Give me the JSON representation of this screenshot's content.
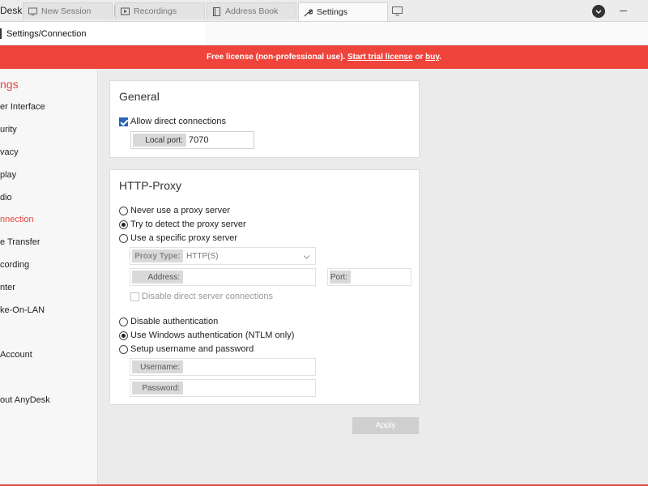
{
  "app": {
    "title": "Desk"
  },
  "tabs": [
    {
      "label": "New Session",
      "icon": "monitor-icon"
    },
    {
      "label": "Recordings",
      "icon": "play-icon"
    },
    {
      "label": "Address Book",
      "icon": "book-icon"
    },
    {
      "label": "Settings",
      "icon": "wrench-icon",
      "active": true
    }
  ],
  "address": {
    "path": "Settings/Connection"
  },
  "banner": {
    "prefix": "Free license (non-professional use). ",
    "trial_link": "Start trial license",
    "middle": " or ",
    "buy_link": "buy",
    "suffix": ".",
    "color": "#ef443b"
  },
  "sidebar": {
    "heading": "ngs",
    "items": [
      {
        "label": "er Interface"
      },
      {
        "label": "urity"
      },
      {
        "label": "vacy"
      },
      {
        "label": "play"
      },
      {
        "label": "dio"
      },
      {
        "label": "nnection",
        "active": true
      },
      {
        "label": "e Transfer"
      },
      {
        "label": "cording"
      },
      {
        "label": "nter"
      },
      {
        "label": "ke-On-LAN"
      },
      {
        "label": " Account"
      },
      {
        "label": "out AnyDesk"
      }
    ]
  },
  "general": {
    "title": "General",
    "allow_direct": {
      "label": "Allow direct connections",
      "checked": true
    },
    "local_port": {
      "label": "Local port:",
      "value": "7070"
    }
  },
  "proxy": {
    "title": "HTTP-Proxy",
    "mode_options": [
      {
        "label": "Never use a proxy server",
        "selected": false
      },
      {
        "label": "Try to detect the proxy server",
        "selected": true
      },
      {
        "label": "Use a specific proxy server",
        "selected": false
      }
    ],
    "proxy_type": {
      "label": "Proxy Type:",
      "value": "HTTP(S)"
    },
    "address": {
      "label": "Address:",
      "value": ""
    },
    "port": {
      "label": "Port:",
      "value": ""
    },
    "disable_direct": {
      "label": "Disable direct server connections",
      "checked": false
    },
    "auth_options": [
      {
        "label": "Disable authentication",
        "selected": false
      },
      {
        "label": "Use Windows authentication (NTLM only)",
        "selected": true
      },
      {
        "label": "Setup username and password",
        "selected": false
      }
    ],
    "username": {
      "label": "Username:",
      "value": ""
    },
    "password": {
      "label": "Password:",
      "value": ""
    }
  },
  "apply": {
    "label": "Apply"
  },
  "colors": {
    "accent": "#e2463e",
    "checkbox": "#2b64b4"
  }
}
